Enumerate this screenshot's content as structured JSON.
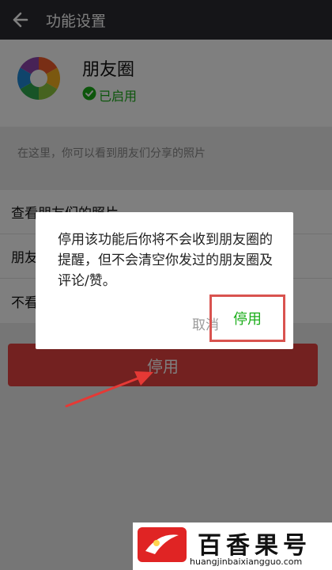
{
  "header": {
    "title": "功能设置",
    "back_icon": "arrow-left-icon"
  },
  "app": {
    "name": "朋友圈",
    "status": "已启用",
    "logo_icon": "camera-aperture-icon",
    "status_icon": "check-circle-icon"
  },
  "description": "在这里，你可以看到朋友们分享的照片",
  "settings": {
    "rows": [
      {
        "label": "查看朋友们的照片"
      },
      {
        "label": "朋友"
      },
      {
        "label": "不看"
      }
    ]
  },
  "disable_button_label": "停用",
  "dialog": {
    "message": "停用该功能后你将不会收到朋友圈的提醒，但不会清空你发过的朋友圈及评论/赞。",
    "cancel_label": "取消",
    "confirm_label": "停用"
  },
  "watermark": {
    "name": "百香果号",
    "url": "huangjinbaixiangguo.com"
  },
  "colors": {
    "topbar": "#2b2b30",
    "accent_green": "#1aad19",
    "danger_red": "#e64340",
    "highlight_box": "#d9534f"
  }
}
